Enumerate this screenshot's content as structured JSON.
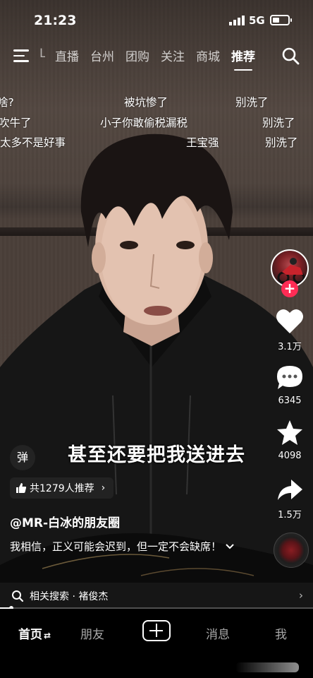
{
  "status_bar": {
    "time": "21:23",
    "network": "5G"
  },
  "top_nav": {
    "partial_tab": "L",
    "tabs": [
      {
        "label": "直播"
      },
      {
        "label": "台州"
      },
      {
        "label": "团购"
      },
      {
        "label": "关注"
      },
      {
        "label": "商城"
      },
      {
        "label": "推荐",
        "active": true
      }
    ]
  },
  "danmaku": [
    {
      "text": "啥?"
    },
    {
      "text": "被坑惨了"
    },
    {
      "text": "别洗了"
    },
    {
      "text": "吹牛了"
    },
    {
      "text": "小子你敢偷税漏税"
    },
    {
      "text": "别洗了"
    },
    {
      "text": "太多不是好事"
    },
    {
      "text": "王宝强"
    },
    {
      "text": "别洗了"
    }
  ],
  "actions": {
    "likes": "3.1万",
    "comments": "6345",
    "favorites": "4098",
    "shares": "1.5万"
  },
  "subtitle": "甚至还要把我送进去",
  "danmu_toggle": "弹",
  "recommend": {
    "label": "共1279人推荐"
  },
  "author": "@MR-白冰的朋友圈",
  "description": "我相信，正义可能会迟到，但一定不会缺席！",
  "related_search": {
    "label": "相关搜索 · 褚俊杰"
  },
  "progress": 0.035,
  "bottom_tabs": {
    "home": "首页",
    "friends": "朋友",
    "messages": "消息",
    "me": "我"
  },
  "colors": {
    "accent": "#fe2c55",
    "background": "#000000"
  },
  "icons": [
    "menu-icon",
    "search-icon",
    "heart-icon",
    "comment-icon",
    "star-icon",
    "share-icon",
    "thumb-up-icon",
    "chevron-right-icon",
    "chevron-down-icon",
    "plus-icon"
  ]
}
